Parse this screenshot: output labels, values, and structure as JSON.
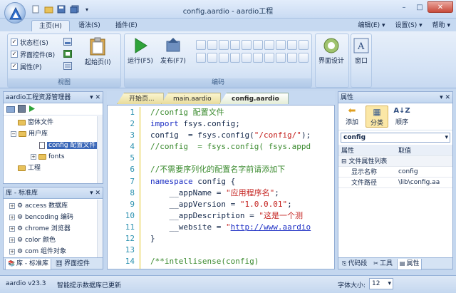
{
  "window": {
    "title": "config.aardio - aardio工程",
    "minimize": "–",
    "maximize": "□",
    "close": "✕"
  },
  "quick_access": [
    "new-file-icon",
    "open-file-icon",
    "save-icon",
    "save-all-icon",
    "dropdown-icon"
  ],
  "ribbon_tabs": [
    {
      "label": "主页(H)",
      "active": true
    },
    {
      "label": "语法(S)"
    },
    {
      "label": "插件(E)"
    }
  ],
  "right_menu": [
    "编辑(E) ▾",
    "设置(S) ▾",
    "帮助 ▾"
  ],
  "ribbon": {
    "view_group": {
      "label": "视图",
      "checkboxes": [
        {
          "label": "状态栏(S)",
          "checked": true
        },
        {
          "label": "界面控件(B)",
          "checked": true
        },
        {
          "label": "属性(P)",
          "checked": true
        }
      ],
      "start_page": "起始页(I)"
    },
    "code_group": {
      "label": "编码",
      "run": "运行(F5)",
      "publish": "发布(F7)"
    },
    "ui_design": "界面设计",
    "window_btn": "窗口"
  },
  "project_panel": {
    "title": "aardio工程资源管理器",
    "tree": [
      {
        "label": "窗体文件",
        "depth": 1
      },
      {
        "label": "用户库",
        "depth": 1,
        "expanded": true
      },
      {
        "label": "config 配置文件",
        "depth": 2,
        "selected": true
      },
      {
        "label": "fonts",
        "depth": 2
      },
      {
        "label": "工程",
        "depth": 1
      }
    ]
  },
  "library_panel": {
    "title": "库 - 标准库",
    "items": [
      "access 数据库",
      "bencoding 编码",
      "chrome 浏览器",
      "color 颜色",
      "com 组件对象"
    ],
    "tabs": [
      "库 - 标准库",
      "界面控件"
    ]
  },
  "editor": {
    "tabs": [
      {
        "label": "开始页..."
      },
      {
        "label": "main.aardio"
      },
      {
        "label": "config.aardio",
        "active": true
      }
    ],
    "line_numbers": [
      "1",
      "2",
      "3",
      "4",
      "5",
      "6",
      "7",
      "8",
      "9",
      "10",
      "11",
      "12",
      "13",
      "14"
    ],
    "lines": [
      [
        {
          "t": "//config 配置文件",
          "c": "cmt"
        }
      ],
      [
        {
          "t": "import",
          "c": "kw"
        },
        {
          "t": " fsys.config;",
          "c": ""
        }
      ],
      [
        {
          "t": "config  = fsys.config(",
          "c": ""
        },
        {
          "t": "\"/config/\"",
          "c": "str"
        },
        {
          "t": ");",
          "c": ""
        }
      ],
      [
        {
          "t": "//config  = fsys.config( fsys.appd",
          "c": "cmt"
        }
      ],
      [
        {
          "t": "",
          "c": ""
        }
      ],
      [
        {
          "t": "//不需要序列化的配置名字前请添加下",
          "c": "cmt"
        }
      ],
      [
        {
          "t": "namespace",
          "c": "kw"
        },
        {
          "t": " config {",
          "c": ""
        }
      ],
      [
        {
          "t": "    __appName = ",
          "c": ""
        },
        {
          "t": "\"应用程序名\"",
          "c": "str"
        },
        {
          "t": ";",
          "c": ""
        }
      ],
      [
        {
          "t": "    __appVersion = ",
          "c": ""
        },
        {
          "t": "\"1.0.0.01\"",
          "c": "str"
        },
        {
          "t": ";",
          "c": ""
        }
      ],
      [
        {
          "t": "    __appDescription = ",
          "c": ""
        },
        {
          "t": "\"这是一个测",
          "c": "str"
        }
      ],
      [
        {
          "t": "    __website = ",
          "c": ""
        },
        {
          "t": "\"",
          "c": "str"
        },
        {
          "t": "http://www.aardio",
          "c": "url"
        }
      ],
      [
        {
          "t": "}",
          "c": ""
        }
      ],
      [
        {
          "t": "",
          "c": ""
        }
      ],
      [
        {
          "t": "/**intellisense(config)",
          "c": "cmt"
        }
      ]
    ]
  },
  "properties": {
    "title": "属性",
    "toolbar": [
      "添加",
      "分类",
      "顺序"
    ],
    "selector": "config",
    "col_headers": [
      "属性",
      "取值"
    ],
    "category": "文件属性列表",
    "rows": [
      {
        "name": "显示名称",
        "value": "config"
      },
      {
        "name": "文件路径",
        "value": "\\lib\\config.aa"
      }
    ],
    "tabs": [
      "代码段",
      "工具",
      "属性"
    ]
  },
  "status": {
    "version": "aardio v23.3",
    "message": "智能提示数据库已更新",
    "font_label": "字体大小:",
    "font_size": "12"
  }
}
